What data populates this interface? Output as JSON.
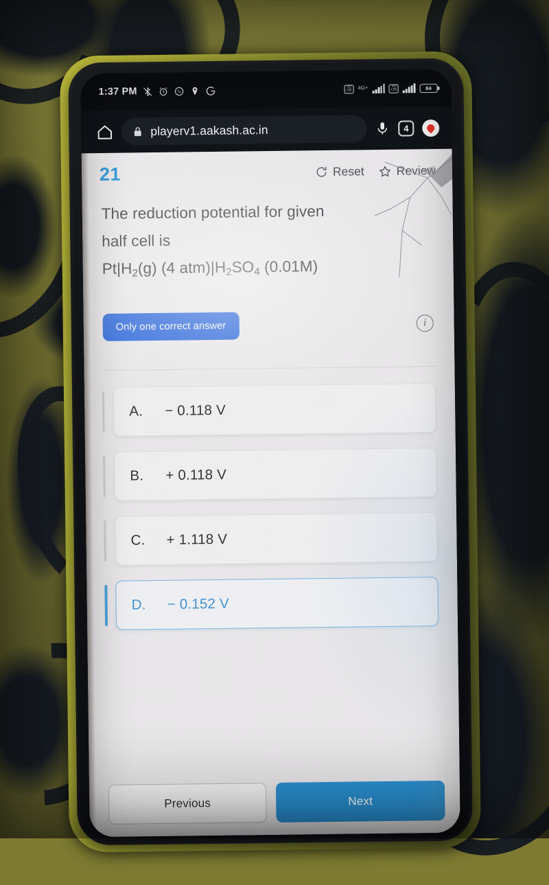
{
  "status_bar": {
    "time": "1:37 PM",
    "left_icons": [
      "bluetooth-off-icon",
      "alarm-icon",
      "whatsapp-icon",
      "location-icon",
      "google-icon"
    ],
    "sim1_label": "VO\\nLTE",
    "network_label": "4G+",
    "sim2_label": "VO\\nLTE",
    "battery_level": "84"
  },
  "browser": {
    "home_icon": "home-icon",
    "lock_icon": "lock-icon",
    "url": "playerv1.aakash.ac.in",
    "mic_icon": "microphone-icon",
    "tab_count": "4",
    "profile_icon": "profile-icon"
  },
  "question": {
    "number": "21",
    "reset_label": "Reset",
    "review_label": "Review",
    "text_line1": "The reduction potential for given",
    "text_line2": "half cell is",
    "formula_pre": "Pt|H",
    "formula_sub1": "2",
    "formula_mid": "(g) (4 atm)|H",
    "formula_sub2": "2",
    "formula_mid2": "SO",
    "formula_sub3": "4",
    "formula_end": " (0.01M)",
    "badge_label": "Only one correct answer",
    "info_icon": "info-icon"
  },
  "options": [
    {
      "letter": "A.",
      "text": "− 0.118 V",
      "selected": false
    },
    {
      "letter": "B.",
      "text": "+ 0.118 V",
      "selected": false
    },
    {
      "letter": "C.",
      "text": "+ 1.118 V",
      "selected": false
    },
    {
      "letter": "D.",
      "text": "− 0.152 V",
      "selected": true
    }
  ],
  "footer": {
    "previous_label": "Previous",
    "next_label": "Next"
  },
  "colors": {
    "question_number": "#1a8fd8",
    "badge_bg": "#2060dd",
    "next_button_bg": "#2a8fd0",
    "selected_option_text": "#3d93d4",
    "selected_option_border": "#7cb8e2"
  }
}
